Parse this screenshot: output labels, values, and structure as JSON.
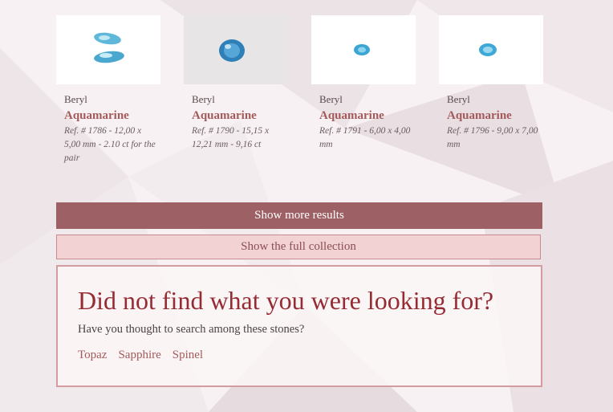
{
  "results": [
    {
      "family": "Beryl",
      "name": "Aquamarine",
      "ref": "Ref. # 1786 - 12,00 x 5,00 mm - 2.10 ct for the pair",
      "image_icon": "aquamarine-pair-image"
    },
    {
      "family": "Beryl",
      "name": "Aquamarine",
      "ref": "Ref. # 1790 - 15,15 x 12,21 mm - 9,16 ct",
      "image_icon": "aquamarine-oval-image"
    },
    {
      "family": "Beryl",
      "name": "Aquamarine",
      "ref": "Ref. # 1791 - 6,00 x 4,00 mm",
      "image_icon": "aquamarine-small-oval-image"
    },
    {
      "family": "Beryl",
      "name": "Aquamarine",
      "ref": "Ref. # 1796 - 9,00 x 7,00 mm",
      "image_icon": "aquamarine-oval-image"
    }
  ],
  "buttons": {
    "show_more": "Show more results",
    "full_collection": "Show the full collection"
  },
  "not_found": {
    "title": "Did not find what you were looking for?",
    "subtitle": "Have you thought to search among these stones?",
    "links": [
      "Topaz",
      "Sapphire",
      "Spinel"
    ]
  },
  "colors": {
    "accent": "#9d6064",
    "title": "#962b34",
    "link": "#a45a5a",
    "light_button": "#f3d2d4",
    "gem_blue": "#4fb3d9"
  }
}
